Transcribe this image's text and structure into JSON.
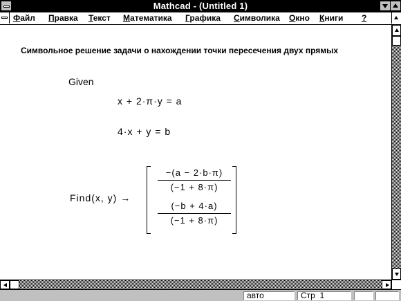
{
  "window": {
    "title": "Mathcad - (Untitled 1)"
  },
  "menu": [
    {
      "pre": "",
      "u": "Ф",
      "post": "айл"
    },
    {
      "pre": "",
      "u": "П",
      "post": "равка"
    },
    {
      "pre": "",
      "u": "Т",
      "post": "екст"
    },
    {
      "pre": "",
      "u": "М",
      "post": "атематика"
    },
    {
      "pre": "",
      "u": "Г",
      "post": "рафика"
    },
    {
      "pre": "",
      "u": "С",
      "post": "имволика"
    },
    {
      "pre": "",
      "u": "О",
      "post": "кно"
    },
    {
      "pre": "",
      "u": "К",
      "post": "ниги"
    },
    {
      "pre": "",
      "u": "?",
      "post": ""
    }
  ],
  "document": {
    "heading": "Символьное решение задачи о нахождении точки пересечения двух прямых",
    "given": "Given",
    "equation1": "x + 2·π·y = a",
    "equation2": "4·x + y = b",
    "find_call": "Find(x, y)  →",
    "result": {
      "row1": {
        "numerator": "−(a − 2·b·π)",
        "denominator": "(−1 + 8·π)"
      },
      "row2": {
        "numerator": "(−b + 4·a)",
        "denominator": "(−1 + 8·π)"
      }
    }
  },
  "status": {
    "mode": "авто",
    "page_label": "Стр",
    "page_number": "1"
  }
}
